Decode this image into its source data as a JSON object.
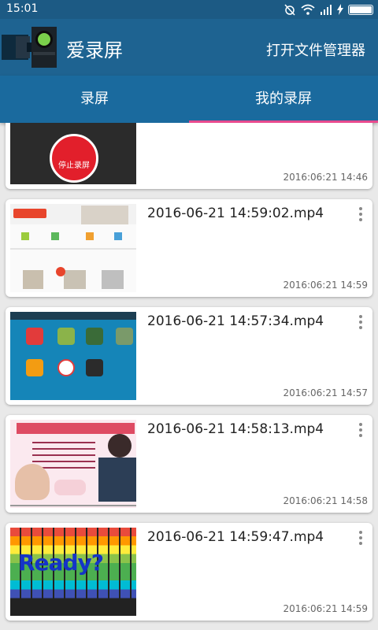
{
  "status": {
    "time": "15:01"
  },
  "appbar": {
    "title": "爱录屏",
    "open_file_manager": "打开文件管理器"
  },
  "tabs": [
    {
      "label": "录屏",
      "selected": false
    },
    {
      "label": "我的录屏",
      "selected": true
    }
  ],
  "colors": {
    "status_bar": "#1c5a84",
    "app_bar": "#1e6391",
    "tab_bar": "#1a6a9e",
    "tab_indicator": "#e84a8e"
  },
  "recordings": [
    {
      "filename": "",
      "timestamp": "2016:06:21 14:46",
      "thumb_text": "停止录屏"
    },
    {
      "filename": "2016-06-21 14:59:02.mp4",
      "timestamp": "2016:06:21 14:59"
    },
    {
      "filename": "2016-06-21 14:57:34.mp4",
      "timestamp": "2016:06:21 14:57"
    },
    {
      "filename": "2016-06-21 14:58:13.mp4",
      "timestamp": "2016:06:21 14:58"
    },
    {
      "filename": "2016-06-21 14:59:47.mp4",
      "timestamp": "2016:06:21 14:59",
      "thumb_text": "Ready?"
    }
  ]
}
